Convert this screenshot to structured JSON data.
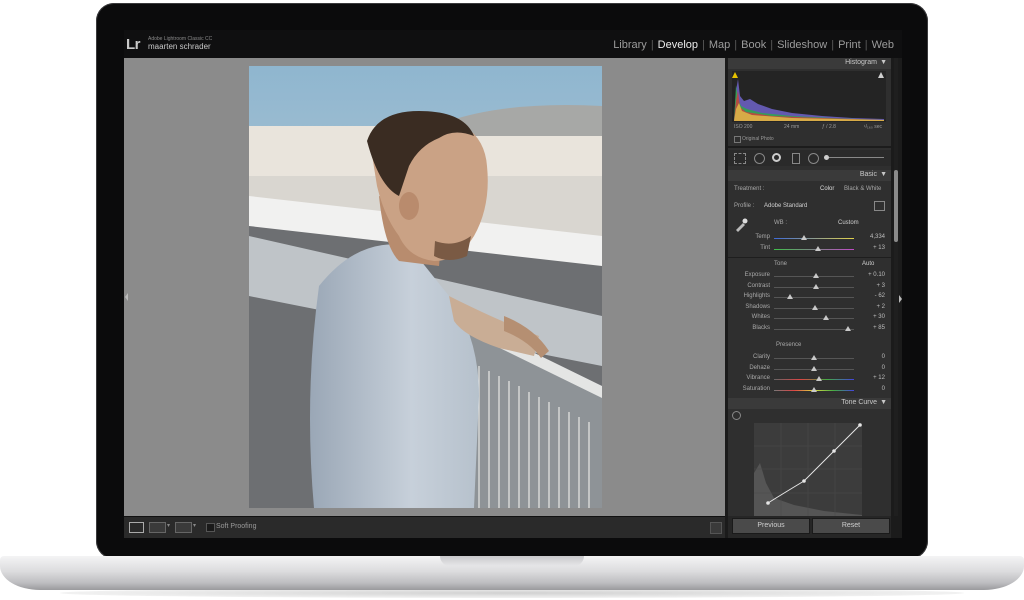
{
  "app": {
    "logo": "Lr",
    "product": "Adobe Lightroom Classic CC",
    "user": "maarten schrader"
  },
  "modules": [
    {
      "label": "Library",
      "active": false
    },
    {
      "label": "Develop",
      "active": true
    },
    {
      "label": "Map",
      "active": false
    },
    {
      "label": "Book",
      "active": false
    },
    {
      "label": "Slideshow",
      "active": false
    },
    {
      "label": "Print",
      "active": false
    },
    {
      "label": "Web",
      "active": false
    }
  ],
  "histogram": {
    "title": "Histogram",
    "info": {
      "iso": "ISO 200",
      "focal": "24 mm",
      "aperture": "ƒ / 2.8",
      "shutter": "¹/₁₆₀ sec"
    },
    "original_photo": "Original Photo"
  },
  "basic": {
    "title": "Basic",
    "treatment_label": "Treatment :",
    "treatment_color": "Color",
    "treatment_bw": "Black & White",
    "profile_label": "Profile :",
    "profile_value": "Adobe Standard",
    "wb_label": "WB :",
    "wb_value": "Custom",
    "temp": {
      "label": "Temp",
      "value": "4,334",
      "level": 0.38
    },
    "tint": {
      "label": "Tint",
      "value": "+ 13",
      "level": 0.55
    },
    "tone_label": "Tone",
    "auto": "Auto",
    "tone": [
      {
        "label": "Exposure",
        "value": "+ 0.10",
        "level": 0.52
      },
      {
        "label": "Contrast",
        "value": "+ 3",
        "level": 0.52
      },
      {
        "label": "Highlights",
        "value": "- 62",
        "level": 0.2
      },
      {
        "label": "Shadows",
        "value": "+ 2",
        "level": 0.51
      },
      {
        "label": "Whites",
        "value": "+ 30",
        "level": 0.65
      },
      {
        "label": "Blacks",
        "value": "+ 85",
        "level": 0.92
      }
    ],
    "presence_label": "Presence",
    "presence": [
      {
        "label": "Clarity",
        "value": "0",
        "level": 0.5
      },
      {
        "label": "Dehaze",
        "value": "0",
        "level": 0.5
      },
      {
        "label": "Vibrance",
        "value": "+ 12",
        "level": 0.56
      },
      {
        "label": "Saturation",
        "value": "0",
        "level": 0.5
      }
    ]
  },
  "tone_curve": {
    "title": "Tone Curve"
  },
  "bottom": {
    "soft_proofing": "Soft Proofing"
  },
  "buttons": {
    "previous": "Previous",
    "reset": "Reset"
  },
  "colors": {
    "accent_active": "#ececec",
    "panel": "#2f2f2f",
    "canvas": "#8b8b8b"
  }
}
